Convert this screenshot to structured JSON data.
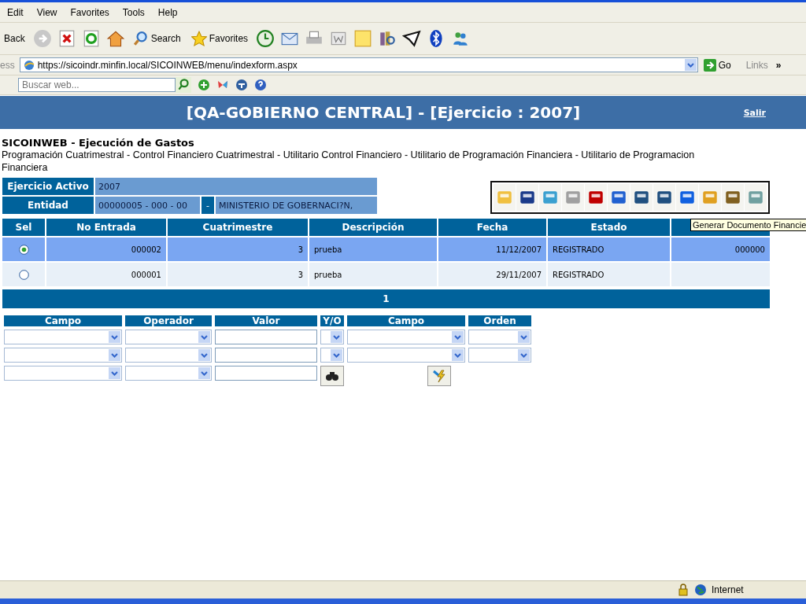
{
  "menu": [
    "Edit",
    "View",
    "Favorites",
    "Tools",
    "Help"
  ],
  "toolbar": {
    "back": "Back",
    "search": "Search",
    "favorites": "Favorites"
  },
  "address": {
    "label": "ess",
    "url": "https://sicoindr.minfin.local/SICOINWEB/menu/indexform.aspx",
    "go": "Go",
    "links": "Links",
    "more": "»"
  },
  "search_bar": {
    "placeholder": "Buscar web..."
  },
  "banner": {
    "title": "[QA-GOBIERNO CENTRAL] - [Ejercicio : 2007]",
    "logout": "Salir"
  },
  "app_title": "SICOINWEB - Ejecución de Gastos",
  "breadcrumb": "Programación Cuatrimestral - Control Financiero Cuatrimestral - Utilitario Control Financiero - Utilitario de Programación Financiera - Utilitario de Programacion Financiera",
  "info": {
    "ejercicio_label": "Ejercicio Activo",
    "ejercicio_value": "2007",
    "entidad_label": "Entidad",
    "entidad_code": "00000005 - 000 - 00",
    "separator": "-",
    "entidad_name": "MINISTERIO DE GOBERNACI?N,"
  },
  "tooltip": "Generar Documento Financie",
  "table": {
    "columns": [
      "Sel",
      "No Entrada",
      "Cuatrimestre",
      "Descripción",
      "Fecha",
      "Estado"
    ],
    "rows": [
      {
        "selected": true,
        "cells": [
          "000002",
          "3",
          "prueba",
          "11/12/2007",
          "REGISTRADO",
          "000000"
        ]
      },
      {
        "selected": false,
        "cells": [
          "000001",
          "3",
          "prueba",
          "29/11/2007",
          "REGISTRADO",
          ""
        ]
      }
    ],
    "pager": "1"
  },
  "filters": {
    "columns": [
      "Campo",
      "Operador",
      "Valor",
      "Y/O"
    ]
  },
  "order": {
    "columns": [
      "Campo",
      "Orden"
    ]
  },
  "status_bar": {
    "zone": "Internet"
  }
}
